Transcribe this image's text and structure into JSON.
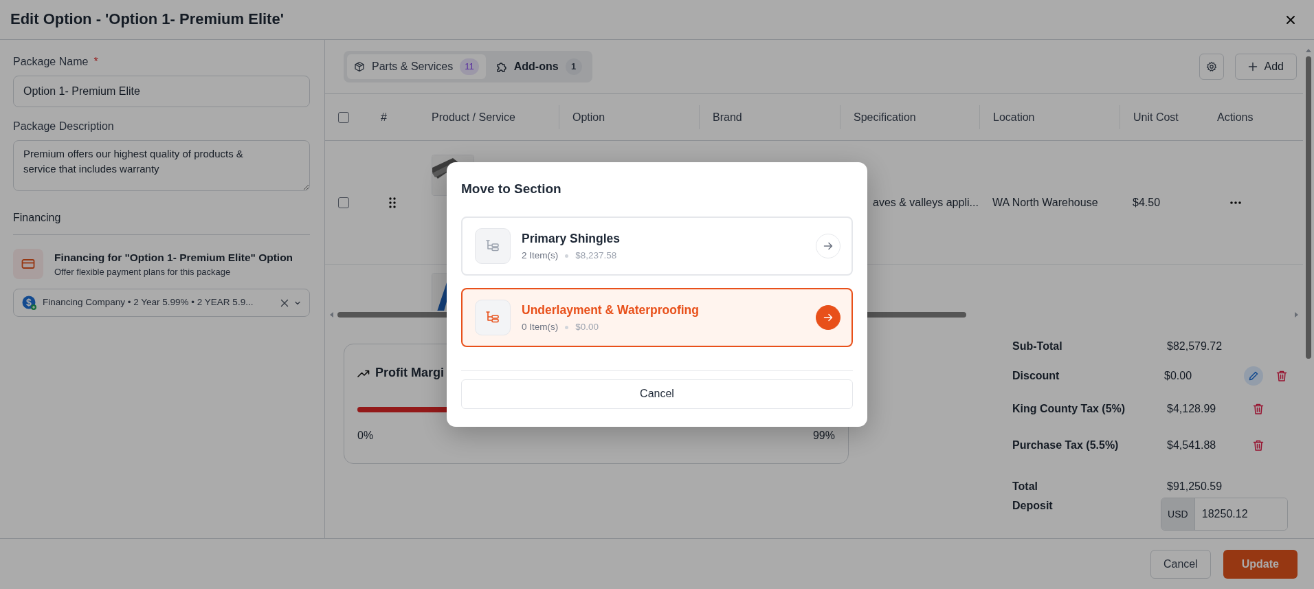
{
  "dialog": {
    "title": "Edit Option - 'Option 1- Premium Elite'"
  },
  "form": {
    "name_label": "Package Name",
    "required_mark": "*",
    "name_value": "Option 1- Premium Elite",
    "description_label": "Package Description",
    "description_value": "Premium offers our highest quality of products & service that includes warranty",
    "financing_heading": "Financing",
    "financing_title": "Financing for \"Option 1- Premium Elite\" Option",
    "financing_subtitle": "Offer flexible payment plans for this package",
    "financing_logo": "$",
    "financing_value": "Financing Company • 2 Year 5.99% • 2 YEAR 5.9..."
  },
  "tabs": [
    {
      "label": "Parts & Services",
      "count": "11",
      "selected": true,
      "kind": "box"
    },
    {
      "label": "Add-ons",
      "count": "1",
      "selected": false,
      "kind": "puzzle"
    }
  ],
  "toolbar": {
    "add_label": "Add"
  },
  "table": {
    "all_checked": false,
    "columns": [
      "#",
      "Product / Service",
      "Option",
      "Brand",
      "Specification",
      "Location",
      "Unit Cost",
      "Actions"
    ],
    "rows": [
      {
        "checked": false,
        "specification": "aves & valleys appli...",
        "location": "WA North Warehouse",
        "unit_cost": "$4.50"
      }
    ]
  },
  "profit_margin": {
    "title": "Profit Margi",
    "level": 0.3,
    "min_label": "0%",
    "max_label": "99%"
  },
  "totals": [
    {
      "kind": "line",
      "label": "Sub-Total",
      "value": "$82,579.72",
      "editable": false,
      "removable": false
    },
    {
      "kind": "line",
      "label": "Discount",
      "value": "$0.00",
      "editable": true,
      "removable": true
    },
    {
      "kind": "line",
      "label": "King County Tax (5%)",
      "value": "$4,128.99",
      "editable": false,
      "removable": true
    },
    {
      "kind": "line",
      "label": "Purchase Tax (5.5%)",
      "value": "$4,541.88",
      "editable": false,
      "removable": true
    },
    {
      "kind": "total",
      "label": "Total",
      "value": "$91,250.59",
      "editable": false,
      "removable": false
    }
  ],
  "deposit": {
    "label": "Deposit",
    "currency": "USD",
    "value": "18250.12"
  },
  "footer": {
    "cancel": "Cancel",
    "submit": "Update"
  },
  "modal": {
    "title": "Move to Section",
    "cancel": "Cancel",
    "sections": [
      {
        "name": "Primary Shingles",
        "items": "2 Item(s)",
        "amount": "$8,237.58",
        "selected": false
      },
      {
        "name": "Underlayment & Waterproofing",
        "items": "0 Item(s)",
        "amount": "$0.00",
        "selected": true
      }
    ]
  }
}
